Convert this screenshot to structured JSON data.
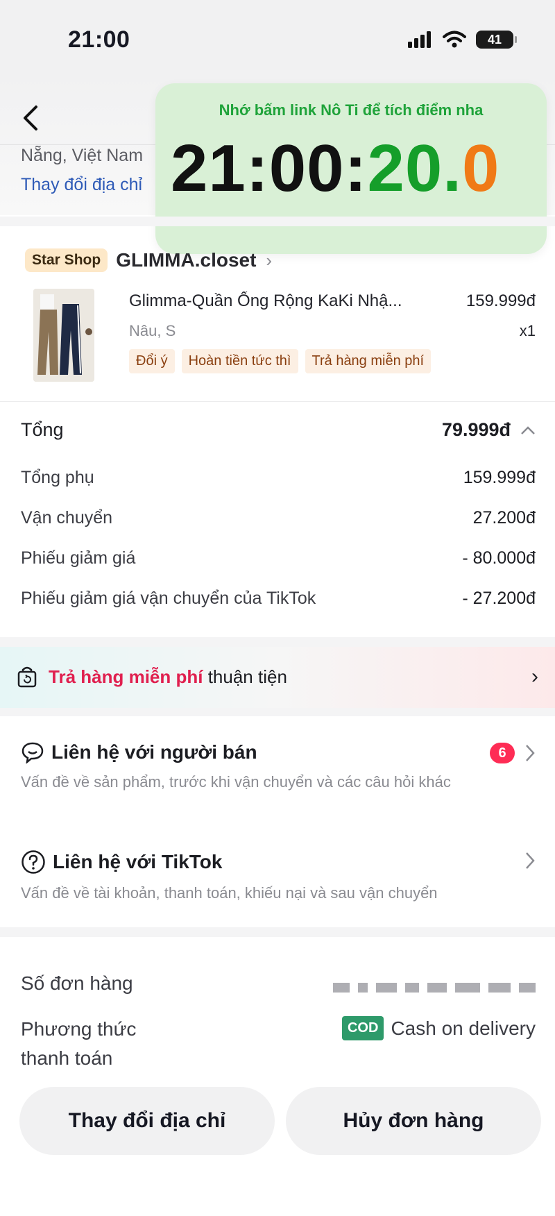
{
  "status_bar": {
    "time": "21:00",
    "battery": "41"
  },
  "address": {
    "line": "Nẵng, Việt Nam",
    "change_link": "Thay đổi địa chỉ"
  },
  "overlay": {
    "note": "Nhớ bấm link Nô Ti để tích điểm nha",
    "clock_hm": "21:00:",
    "clock_s": "20.",
    "clock_ms": "0"
  },
  "shop": {
    "badge": "Star Shop",
    "name": "GLIMMA.closet",
    "chevron": "›"
  },
  "product": {
    "title": "Glimma-Quần Ống Rộng KaKi Nhậ...",
    "price": "159.999đ",
    "variant": "Nâu, S",
    "quantity": "x1",
    "tags": [
      "Đổi ý",
      "Hoàn tiền tức thì",
      "Trả hàng miễn phí"
    ]
  },
  "summary": {
    "total_label": "Tổng",
    "total_value": "79.999đ",
    "rows": [
      {
        "label": "Tổng phụ",
        "value": "159.999đ"
      },
      {
        "label": "Vận chuyển",
        "value": "27.200đ"
      },
      {
        "label": "Phiếu giảm giá",
        "value": "- 80.000đ"
      },
      {
        "label": "Phiếu giảm giá vận chuyển của TikTok",
        "value": "- 27.200đ"
      }
    ]
  },
  "return_banner": {
    "highlight": "Trả hàng miễn phí",
    "rest": " thuận tiện",
    "chevron": "›"
  },
  "contacts": [
    {
      "title": "Liên hệ với người bán",
      "subtitle": "Vấn đề về sản phẩm, trước khi vận chuyển và các câu hỏi khác",
      "badge": "6",
      "icon": "chat-bubble-icon"
    },
    {
      "title": "Liên hệ với TikTok",
      "subtitle": "Vấn đề về tài khoản, thanh toán, khiếu nại và sau vận chuyển",
      "badge": "",
      "icon": "help-circle-icon"
    }
  ],
  "order_info": {
    "order_number_label": "Số đơn hàng",
    "payment_label_line1": "Phương thức",
    "payment_label_line2": "thanh toán",
    "cod_badge": "COD",
    "payment_value": "Cash on delivery"
  },
  "buttons": {
    "change_address": "Thay đổi địa chỉ",
    "cancel_order": "Hủy đơn hàng"
  },
  "colors": {
    "accent_red": "#fe2c55",
    "clock_green": "#159e2a",
    "clock_orange": "#f07a16",
    "link_blue": "#2f5bb7",
    "cod_green": "#2e9a6a"
  }
}
